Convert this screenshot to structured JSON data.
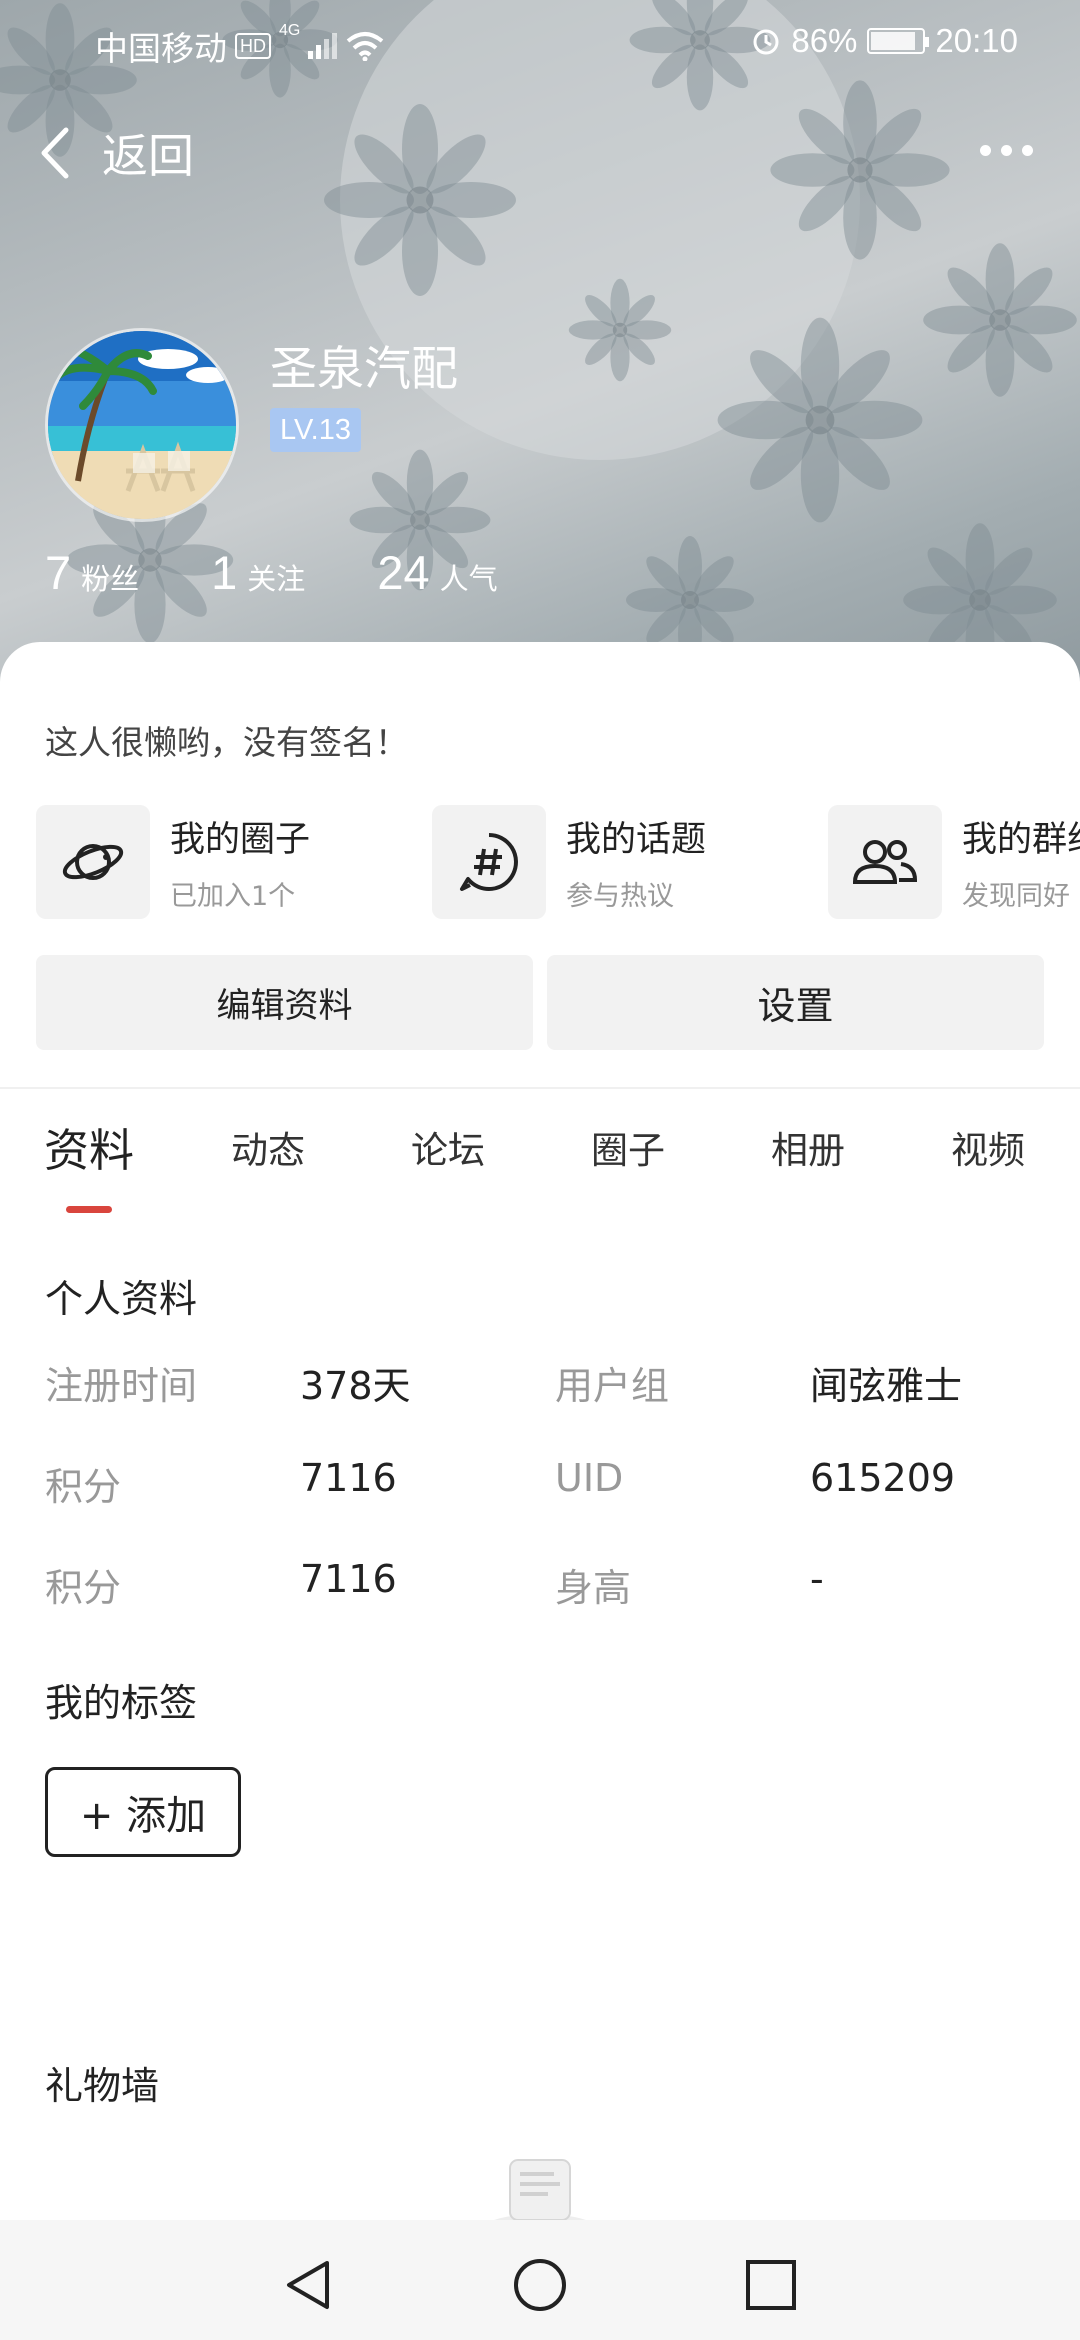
{
  "status_bar": {
    "carrier": "中国移动",
    "hd": "HD",
    "network": "4G",
    "battery": "86%",
    "time": "20:10",
    "icons": [
      "signal-icon",
      "wifi-icon",
      "alarm-icon",
      "battery-icon"
    ]
  },
  "nav": {
    "back_label": "返回",
    "icons": [
      "chevron-left-icon",
      "more-icon"
    ]
  },
  "profile": {
    "name": "圣泉汽配",
    "level": "LV.13",
    "stats": [
      {
        "num": "7",
        "label": "粉丝"
      },
      {
        "num": "1",
        "label": "关注"
      },
      {
        "num": "24",
        "label": "人气"
      }
    ],
    "signature": "这人很懒哟，没有签名！"
  },
  "shortcuts": [
    {
      "title": "我的圈子",
      "subtitle": "已加入1个",
      "icon": "planet-icon"
    },
    {
      "title": "我的话题",
      "subtitle": "参与热议",
      "icon": "topic-hash-icon"
    },
    {
      "title": "我的群组",
      "subtitle": "发现同好",
      "icon": "group-icon"
    }
  ],
  "actions": {
    "edit_profile": "编辑资料",
    "settings": "设置"
  },
  "tabs": [
    "资料",
    "动态",
    "论坛",
    "圈子",
    "相册",
    "视频"
  ],
  "active_tab": "资料",
  "personal_info": {
    "title": "个人资料",
    "rows": [
      {
        "k1": "注册时间",
        "v1": "378天",
        "k2": "用户组",
        "v2": "闻弦雅士"
      },
      {
        "k1": "积分",
        "v1": "7116",
        "k2": "UID",
        "v2": "615209"
      },
      {
        "k1": "积分",
        "v1": "7116",
        "k2": "身高",
        "v2": "-"
      }
    ]
  },
  "tags": {
    "title": "我的标签",
    "add_label": "+ 添加"
  },
  "gift_wall": {
    "title": "礼物墙"
  },
  "colors": {
    "accent": "#d9453d",
    "level_badge": "#a9c7f2",
    "button_bg": "#f2f2f2"
  }
}
